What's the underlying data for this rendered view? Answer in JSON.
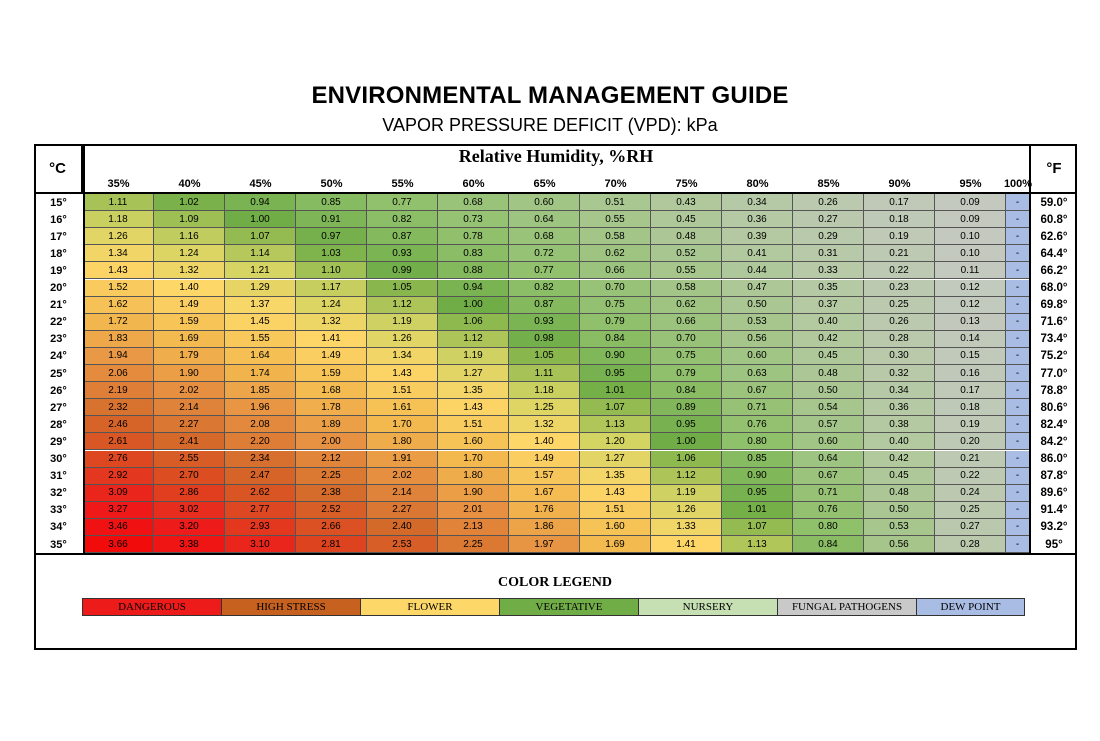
{
  "header": {
    "title": "ENVIRONMENTAL MANAGEMENT GUIDE",
    "subtitle": "VAPOR PRESSURE DEFICIT (VPD): kPa"
  },
  "axes": {
    "celsius_label": "°C",
    "fahrenheit_label": "°F",
    "rh_title": "Relative Humidity, %RH"
  },
  "legend": {
    "title": "COLOR LEGEND",
    "items": [
      {
        "label": "DANGEROUS",
        "color": "#ee1b1b"
      },
      {
        "label": "HIGH STRESS",
        "color": "#c7611f"
      },
      {
        "label": "FLOWER",
        "color": "#fdd768"
      },
      {
        "label": "VEGETATIVE",
        "color": "#70ad47"
      },
      {
        "label": "NURSERY",
        "color": "#c6e0b4"
      },
      {
        "label": "FUNGAL PATHOGENS",
        "color": "#c9c9c9"
      },
      {
        "label": "DEW POINT",
        "color": "#a9bde4"
      }
    ]
  },
  "chart_data": {
    "type": "heatmap",
    "title": "ENVIRONMENTAL MANAGEMENT GUIDE",
    "subtitle": "VAPOR PRESSURE DEFICIT (VPD): kPa",
    "xlabel": "Relative Humidity, %RH",
    "x": [
      "35%",
      "40%",
      "45%",
      "50%",
      "55%",
      "60%",
      "65%",
      "70%",
      "75%",
      "80%",
      "85%",
      "90%",
      "95%",
      "100%"
    ],
    "y_celsius": [
      "15°",
      "16°",
      "17°",
      "18°",
      "19°",
      "20°",
      "21°",
      "22°",
      "23°",
      "24°",
      "25°",
      "26°",
      "27°",
      "28°",
      "29°",
      "30°",
      "31°",
      "32°",
      "33°",
      "34°",
      "35°"
    ],
    "y_fahrenheit": [
      "59.0°",
      "60.8°",
      "62.6°",
      "64.4°",
      "66.2°",
      "68.0°",
      "69.8°",
      "71.6°",
      "73.4°",
      "75.2°",
      "77.0°",
      "78.8°",
      "80.6°",
      "82.4°",
      "84.2°",
      "86.0°",
      "87.8°",
      "89.6°",
      "91.4°",
      "93.2°",
      "95°"
    ],
    "values": [
      [
        "1.11",
        "1.02",
        "0.94",
        "0.85",
        "0.77",
        "0.68",
        "0.60",
        "0.51",
        "0.43",
        "0.34",
        "0.26",
        "0.17",
        "0.09",
        "-"
      ],
      [
        "1.18",
        "1.09",
        "1.00",
        "0.91",
        "0.82",
        "0.73",
        "0.64",
        "0.55",
        "0.45",
        "0.36",
        "0.27",
        "0.18",
        "0.09",
        "-"
      ],
      [
        "1.26",
        "1.16",
        "1.07",
        "0.97",
        "0.87",
        "0.78",
        "0.68",
        "0.58",
        "0.48",
        "0.39",
        "0.29",
        "0.19",
        "0.10",
        "-"
      ],
      [
        "1.34",
        "1.24",
        "1.14",
        "1.03",
        "0.93",
        "0.83",
        "0.72",
        "0.62",
        "0.52",
        "0.41",
        "0.31",
        "0.21",
        "0.10",
        "-"
      ],
      [
        "1.43",
        "1.32",
        "1.21",
        "1.10",
        "0.99",
        "0.88",
        "0.77",
        "0.66",
        "0.55",
        "0.44",
        "0.33",
        "0.22",
        "0.11",
        "-"
      ],
      [
        "1.52",
        "1.40",
        "1.29",
        "1.17",
        "1.05",
        "0.94",
        "0.82",
        "0.70",
        "0.58",
        "0.47",
        "0.35",
        "0.23",
        "0.12",
        "-"
      ],
      [
        "1.62",
        "1.49",
        "1.37",
        "1.24",
        "1.12",
        "1.00",
        "0.87",
        "0.75",
        "0.62",
        "0.50",
        "0.37",
        "0.25",
        "0.12",
        "-"
      ],
      [
        "1.72",
        "1.59",
        "1.45",
        "1.32",
        "1.19",
        "1.06",
        "0.93",
        "0.79",
        "0.66",
        "0.53",
        "0.40",
        "0.26",
        "0.13",
        "-"
      ],
      [
        "1.83",
        "1.69",
        "1.55",
        "1.41",
        "1.26",
        "1.12",
        "0.98",
        "0.84",
        "0.70",
        "0.56",
        "0.42",
        "0.28",
        "0.14",
        "-"
      ],
      [
        "1.94",
        "1.79",
        "1.64",
        "1.49",
        "1.34",
        "1.19",
        "1.05",
        "0.90",
        "0.75",
        "0.60",
        "0.45",
        "0.30",
        "0.15",
        "-"
      ],
      [
        "2.06",
        "1.90",
        "1.74",
        "1.59",
        "1.43",
        "1.27",
        "1.11",
        "0.95",
        "0.79",
        "0.63",
        "0.48",
        "0.32",
        "0.16",
        "-"
      ],
      [
        "2.19",
        "2.02",
        "1.85",
        "1.68",
        "1.51",
        "1.35",
        "1.18",
        "1.01",
        "0.84",
        "0.67",
        "0.50",
        "0.34",
        "0.17",
        "-"
      ],
      [
        "2.32",
        "2.14",
        "1.96",
        "1.78",
        "1.61",
        "1.43",
        "1.25",
        "1.07",
        "0.89",
        "0.71",
        "0.54",
        "0.36",
        "0.18",
        "-"
      ],
      [
        "2.46",
        "2.27",
        "2.08",
        "1.89",
        "1.70",
        "1.51",
        "1.32",
        "1.13",
        "0.95",
        "0.76",
        "0.57",
        "0.38",
        "0.19",
        "-"
      ],
      [
        "2.61",
        "2.41",
        "2.20",
        "2.00",
        "1.80",
        "1.60",
        "1.40",
        "1.20",
        "1.00",
        "0.80",
        "0.60",
        "0.40",
        "0.20",
        "-"
      ],
      [
        "2.76",
        "2.55",
        "2.34",
        "2.12",
        "1.91",
        "1.70",
        "1.49",
        "1.27",
        "1.06",
        "0.85",
        "0.64",
        "0.42",
        "0.21",
        "-"
      ],
      [
        "2.92",
        "2.70",
        "2.47",
        "2.25",
        "2.02",
        "1.80",
        "1.57",
        "1.35",
        "1.12",
        "0.90",
        "0.67",
        "0.45",
        "0.22",
        "-"
      ],
      [
        "3.09",
        "2.86",
        "2.62",
        "2.38",
        "2.14",
        "1.90",
        "1.67",
        "1.43",
        "1.19",
        "0.95",
        "0.71",
        "0.48",
        "0.24",
        "-"
      ],
      [
        "3.27",
        "3.02",
        "2.77",
        "2.52",
        "2.27",
        "2.01",
        "1.76",
        "1.51",
        "1.26",
        "1.01",
        "0.76",
        "0.50",
        "0.25",
        "-"
      ],
      [
        "3.46",
        "3.20",
        "2.93",
        "2.66",
        "2.40",
        "2.13",
        "1.86",
        "1.60",
        "1.33",
        "1.07",
        "0.80",
        "0.53",
        "0.27",
        "-"
      ],
      [
        "3.66",
        "3.38",
        "3.10",
        "2.81",
        "2.53",
        "2.25",
        "1.97",
        "1.69",
        "1.41",
        "1.13",
        "0.84",
        "0.56",
        "0.28",
        "-"
      ]
    ]
  }
}
